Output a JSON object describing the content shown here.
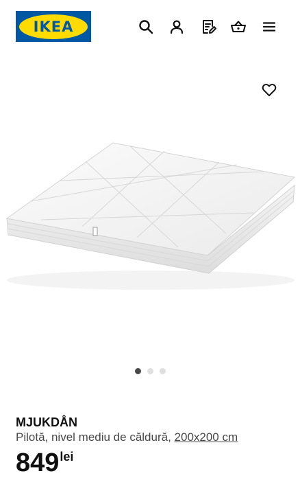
{
  "header": {
    "logo_text": "IKEA",
    "icons": [
      "search-icon",
      "account-icon",
      "shopping-list-icon",
      "basket-icon",
      "menu-icon"
    ]
  },
  "product": {
    "name": "MJUKDÅN",
    "description": "Pilotă, nivel mediu de căldură,",
    "size": "200x200 cm",
    "price_integer": "849",
    "price_currency": "lei",
    "favorite_icon": "heart-icon"
  },
  "carousel": {
    "total": 3,
    "active": 1
  },
  "colors": {
    "brand_blue": "#0058a3",
    "brand_yellow": "#ffdb00",
    "text": "#111111",
    "text_secondary": "#484848"
  }
}
